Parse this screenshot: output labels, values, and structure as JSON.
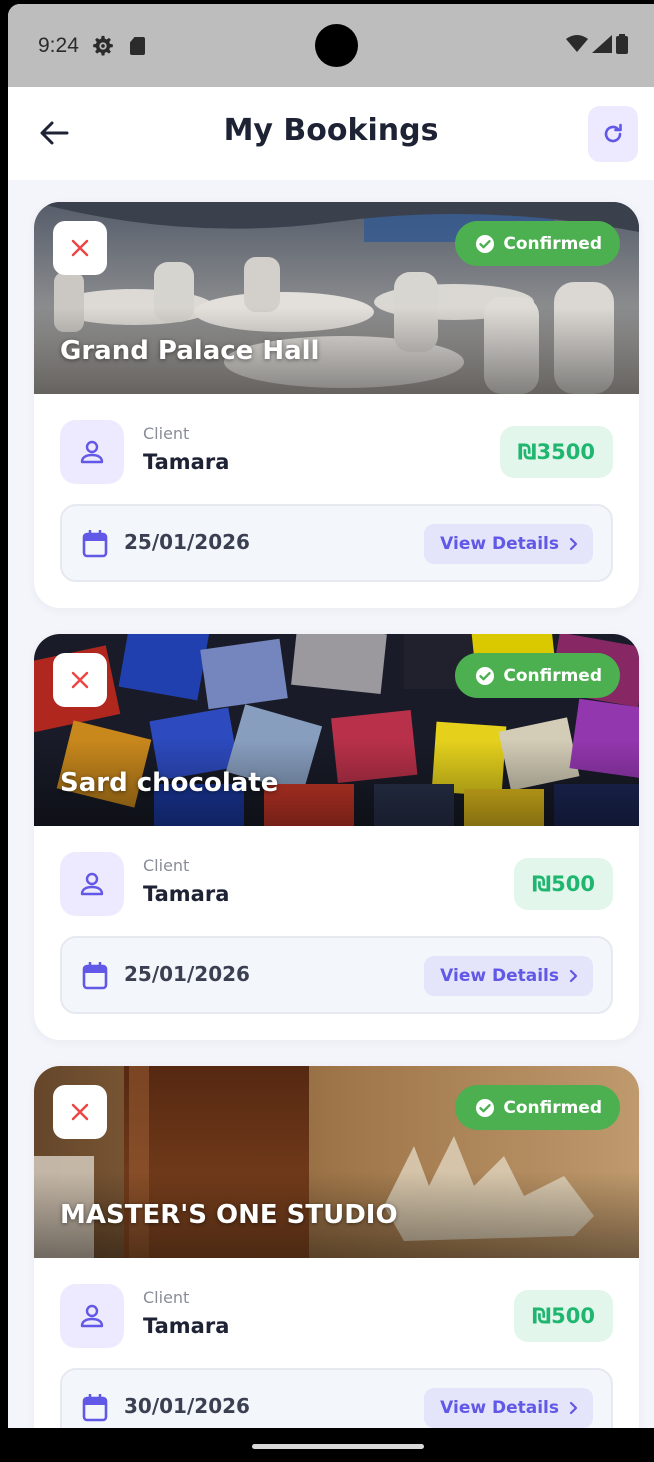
{
  "status_bar": {
    "time": "9:24"
  },
  "header": {
    "title": "My Bookings"
  },
  "bookings": [
    {
      "venue": "Grand Palace Hall",
      "status": "Confirmed",
      "client_caption": "Client",
      "client": "Tamara",
      "price": "₪3500",
      "date": "25/01/2026",
      "details_label": "View Details"
    },
    {
      "venue": "Sard chocolate",
      "status": "Confirmed",
      "client_caption": "Client",
      "client": "Tamara",
      "price": "₪500",
      "date": "25/01/2026",
      "details_label": "View Details"
    },
    {
      "venue": "MASTER'S ONE STUDIO",
      "status": "Confirmed",
      "client_caption": "Client",
      "client": "Tamara",
      "price": "₪500",
      "date": "30/01/2026",
      "details_label": "View Details"
    }
  ],
  "colors": {
    "accent": "#6258e6",
    "confirmed": "#4caf50",
    "price": "#1fb670",
    "cancel": "#ef4444"
  }
}
